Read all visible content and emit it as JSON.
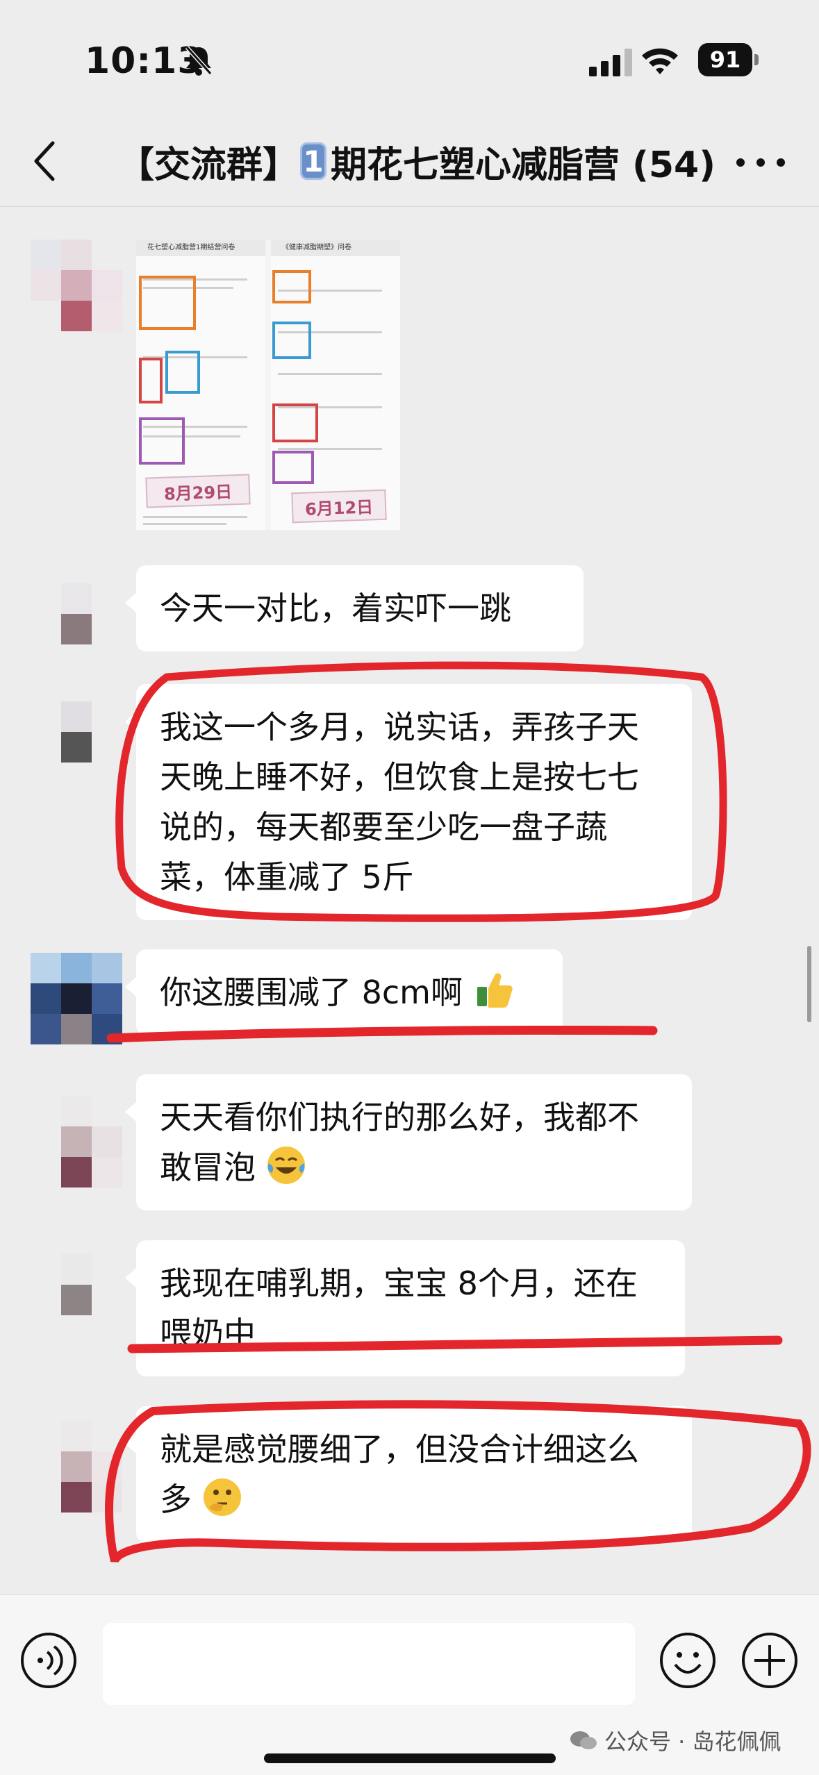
{
  "status": {
    "time": "10:13",
    "battery": "91"
  },
  "nav": {
    "title_prefix": "【交流群】",
    "badge": "1",
    "title_suffix": "期花七塑心减脂营 (54)"
  },
  "screenshot": {
    "left_header": "花七塑心减脂营1期结营问卷",
    "right_header": "《健康减脂期塑》问卷",
    "left_tag": "8月29日",
    "right_tag": "6月12日"
  },
  "messages": [
    {
      "text": "今天一对比，着实吓一跳"
    },
    {
      "text": "我这一个多月，说实话，弄孩子天天晚上睡不好，但饮食上是按七七说的，每天都要至少吃一盘子蔬菜，体重减了 5斤"
    },
    {
      "text": "你这腰围减了 8cm啊",
      "emoji": "thumbs-up"
    },
    {
      "text": "天天看你们执行的那么好，我都不敢冒泡",
      "emoji": "crying-laughing"
    },
    {
      "text": "我现在哺乳期，宝宝 8个月，还在喂奶中"
    },
    {
      "text": "就是感觉腰细了，但没合计细这么多",
      "emoji": "thinking"
    }
  ],
  "watermark": "公众号 · 岛花佩佩",
  "colors": {
    "annotation": "#e3262c",
    "bubble": "#ffffff",
    "background": "#ededed"
  }
}
